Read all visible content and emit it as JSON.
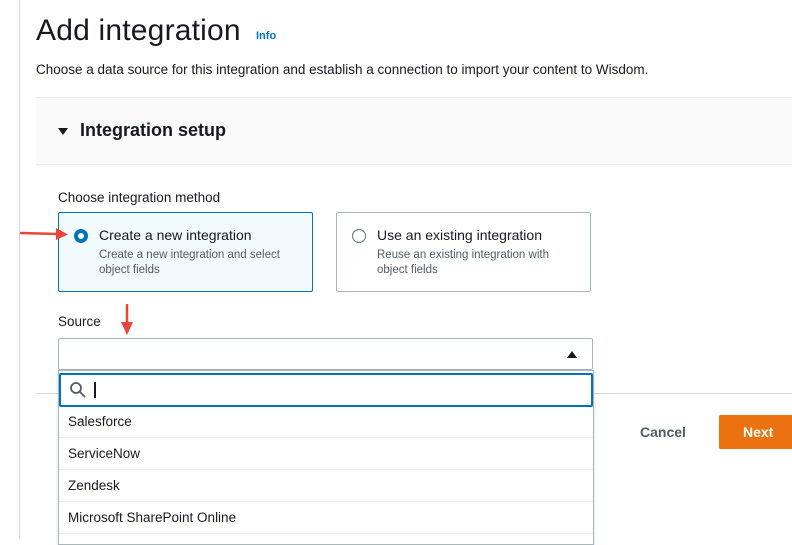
{
  "header": {
    "title": "Add integration",
    "info_link": "Info",
    "description": "Choose a data source for this integration and establish a connection to import your content to Wisdom."
  },
  "integration_setup": {
    "section_title": "Integration setup",
    "method_label": "Choose integration method",
    "options": [
      {
        "title": "Create a new integration",
        "description": "Create a new integration and select object fields",
        "selected": true
      },
      {
        "title": "Use an existing integration",
        "description": "Reuse an existing integration with object fields",
        "selected": false
      }
    ],
    "source_label": "Source",
    "source_value": "",
    "search": {
      "value": "",
      "placeholder": ""
    },
    "source_options": [
      "Salesforce",
      "ServiceNow",
      "Zendesk",
      "Microsoft SharePoint Online"
    ]
  },
  "actions": {
    "cancel_label": "Cancel",
    "next_label": "Next"
  },
  "colors": {
    "accent": "#0073bb",
    "primary_button": "#ec7211",
    "annotation_arrow": "#e8463a"
  },
  "icons": {
    "search": "search-icon",
    "section_toggle": "caret-down-icon",
    "select_toggle": "caret-up-icon"
  }
}
